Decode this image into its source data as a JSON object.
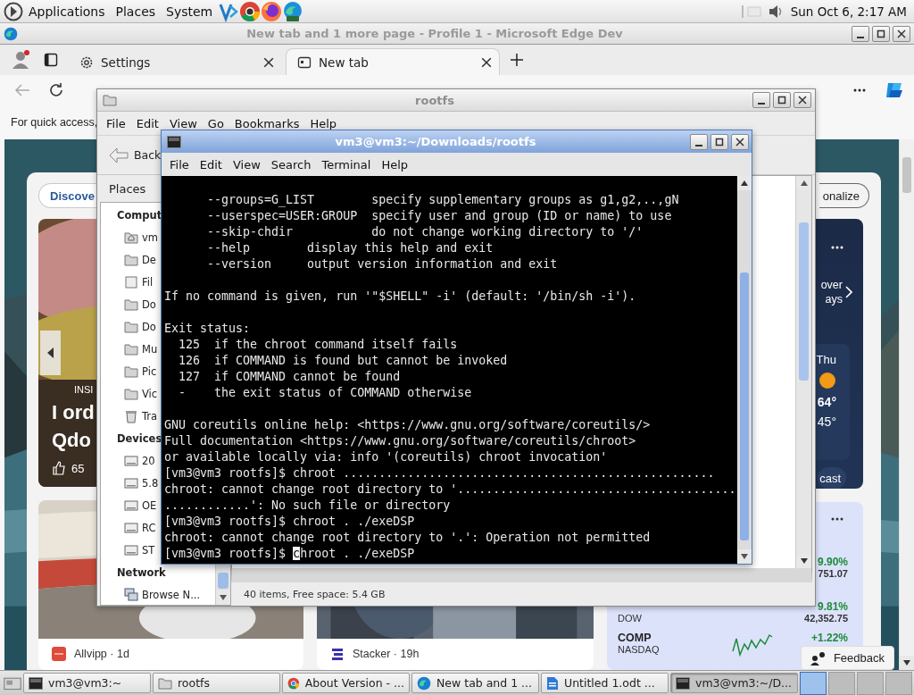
{
  "top_panel": {
    "menus": [
      "Applications",
      "Places",
      "System"
    ],
    "launchers": [
      {
        "kind": "code"
      },
      {
        "kind": "chrome"
      },
      {
        "kind": "firefox"
      },
      {
        "kind": "edge"
      }
    ],
    "clock": "Sun Oct 6, 2:17 AM"
  },
  "browser": {
    "title": "New tab and 1 more page - Profile 1 - Microsoft Edge Dev",
    "tabs": [
      {
        "label": "Settings",
        "kind": "settings",
        "selected": false
      },
      {
        "label": "New tab",
        "kind": "newtab",
        "selected": true
      }
    ],
    "favorites_hint": "For quick access,",
    "feed": {
      "discover": "Discove",
      "personalize": "onalize",
      "hero": {
        "category": "INSI",
        "title_lines": [
          "I ord",
          "Qdo"
        ],
        "likes": "65"
      },
      "cards": [
        {
          "byline": "Allvipp · 1d",
          "kind": "train"
        },
        {
          "byline": "Stacker · 19h",
          "kind": "people"
        }
      ],
      "weather": {
        "note_lines": [
          "over",
          "ays"
        ],
        "day": "Thu",
        "high": "64°",
        "low": "45°",
        "forecast": "cast"
      },
      "stocks": [
        {
          "kind": "plain",
          "change": "9.90%",
          "price": "751.07"
        },
        {
          "kind": "plain",
          "exchange": "DOW",
          "change": "9.81%",
          "price": "42,352.75"
        },
        {
          "kind": "sparkline",
          "symbol": "COMP",
          "exchange": "NASDAQ",
          "change": "+1.22%"
        }
      ],
      "feedback": "Feedback"
    }
  },
  "file_manager": {
    "title": "rootfs",
    "menus": [
      "File",
      "Edit",
      "View",
      "Go",
      "Bookmarks",
      "Help"
    ],
    "back": "Back",
    "pane_title": "Places",
    "sections": [
      {
        "title": "Comput",
        "items": [
          {
            "label": "vm",
            "kind": "home"
          },
          {
            "label": "De",
            "kind": "folder"
          },
          {
            "label": "Fil",
            "kind": "file"
          },
          {
            "label": "Do",
            "kind": "folder"
          },
          {
            "label": "Do",
            "kind": "folder"
          },
          {
            "label": "Mu",
            "kind": "folder"
          },
          {
            "label": "Pic",
            "kind": "folder"
          },
          {
            "label": "Vic",
            "kind": "folder"
          },
          {
            "label": "Tra",
            "kind": "trash"
          }
        ]
      },
      {
        "title": "Devices",
        "items": [
          {
            "label": "20",
            "kind": "drive"
          },
          {
            "label": "5.8",
            "kind": "drive"
          },
          {
            "label": "OE",
            "kind": "drive"
          },
          {
            "label": "RC",
            "kind": "drive"
          },
          {
            "label": "ST",
            "kind": "drive"
          }
        ]
      },
      {
        "title": "Network",
        "items": [
          {
            "label": "Browse N...",
            "kind": "network"
          }
        ]
      }
    ],
    "status": "40 items, Free space: 5.4 GB"
  },
  "terminal": {
    "title": "vm3@vm3:~/Downloads/rootfs",
    "menus": [
      "File",
      "Edit",
      "View",
      "Search",
      "Terminal",
      "Help"
    ],
    "blocks": [
      [
        "      --groups=G_LIST        specify supplementary groups as g1,g2,..,gN",
        "      --userspec=USER:GROUP  specify user and group (ID or name) to use",
        "      --skip-chdir           do not change working directory to '/'",
        "      --help        display this help and exit",
        "      --version     output version information and exit"
      ],
      [
        "If no command is given, run '\"$SHELL\" -i' (default: '/bin/sh -i')."
      ],
      [
        "Exit status:",
        "  125  if the chroot command itself fails",
        "  126  if COMMAND is found but cannot be invoked",
        "  127  if COMMAND cannot be found",
        "  -    the exit status of COMMAND otherwise"
      ],
      [
        "GNU coreutils online help: <https://www.gnu.org/software/coreutils/>",
        "Full documentation <https://www.gnu.org/software/coreutils/chroot>",
        "or available locally via: info '(coreutils) chroot invocation'",
        "[vm3@vm3 rootfs]$ chroot ....................................................",
        "chroot: cannot change root directory to '.......................................",
        "............': No such file or directory",
        "[vm3@vm3 rootfs]$ chroot . ./exeDSP",
        "chroot: cannot change root directory to '.': Operation not permitted"
      ]
    ],
    "input": {
      "prompt": "[vm3@vm3 rootfs]$",
      "command": "chroot . ./exeDSP",
      "cursor": true
    }
  },
  "taskbar": {
    "tasks": [
      {
        "label": "vm3@vm3:~",
        "kind": "terminal",
        "selected": false
      },
      {
        "label": "rootfs",
        "kind": "folder",
        "selected": false
      },
      {
        "label": "About Version - ...",
        "kind": "chrome",
        "selected": false
      },
      {
        "label": "New tab and 1 ...",
        "kind": "edge",
        "selected": false
      },
      {
        "label": "Untitled 1.odt ...",
        "kind": "document",
        "selected": false
      },
      {
        "label": "vm3@vm3:~/D...",
        "kind": "terminal",
        "selected": true
      }
    ]
  }
}
